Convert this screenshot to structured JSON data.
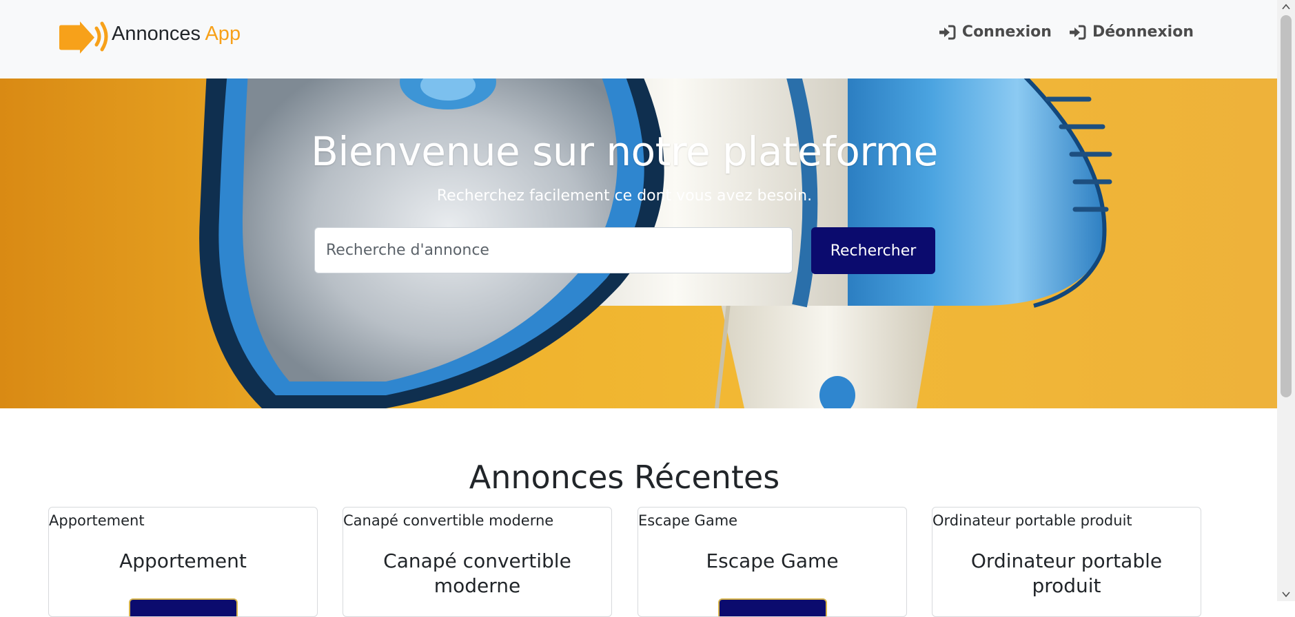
{
  "navbar": {
    "brand_main": "Annonces",
    "brand_accent": "App",
    "brand_color": "#f7a11a",
    "links": [
      {
        "label": "Connexion",
        "icon": "sign-in-icon"
      },
      {
        "label": "Déonnexion",
        "icon": "sign-in-icon"
      }
    ]
  },
  "hero": {
    "title": "Bienvenue sur notre plateforme",
    "subtitle": "Recherchez facilement ce dont vous avez besoin.",
    "search_placeholder": "Recherche d'annonce",
    "search_button": "Rechercher",
    "button_color": "#0b0b6e"
  },
  "recent": {
    "title": "Annonces Récentes",
    "cards": [
      {
        "image_alt": "Apportement",
        "title": "Apportement"
      },
      {
        "image_alt": "Canapé convertible moderne",
        "title": "Canapé convertible moderne"
      },
      {
        "image_alt": "Escape Game",
        "title": "Escape Game"
      },
      {
        "image_alt": "Ordinateur portable produit",
        "title": "Ordinateur portable produit"
      }
    ]
  }
}
